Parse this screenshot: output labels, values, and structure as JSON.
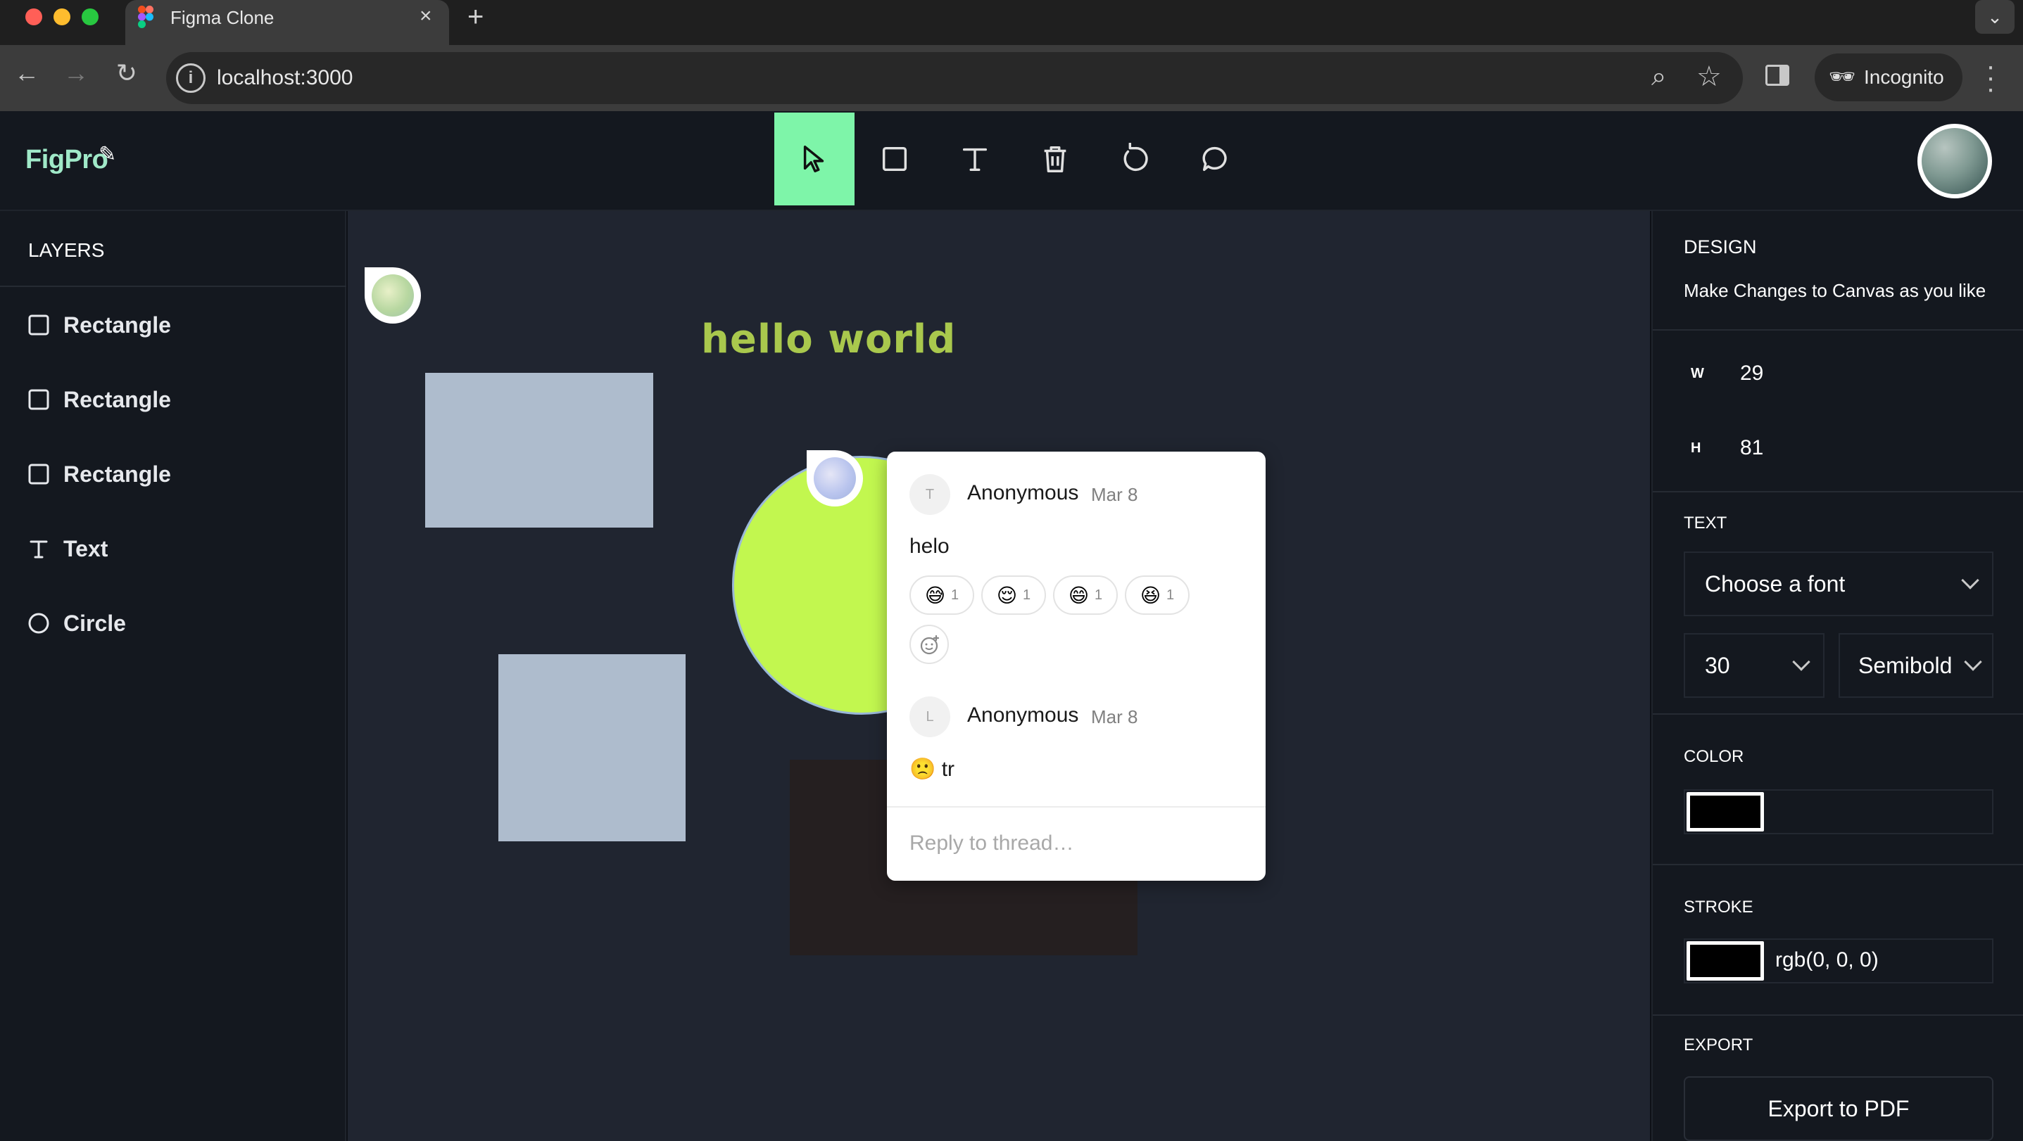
{
  "browser": {
    "tab_title": "Figma Clone",
    "url": "localhost:3000",
    "incognito_label": "Incognito"
  },
  "header": {
    "logo": "FigPro",
    "tools": [
      "select-tool",
      "rectangle-tool",
      "text-tool",
      "delete-tool",
      "reset-tool",
      "comments-tool"
    ],
    "active_tool": "select-tool",
    "active_color": "#7ef5a9"
  },
  "layers": {
    "title": "LAYERS",
    "items": [
      {
        "label": "Rectangle",
        "icon": "square-icon"
      },
      {
        "label": "Rectangle",
        "icon": "square-icon"
      },
      {
        "label": "Rectangle",
        "icon": "square-icon"
      },
      {
        "label": "Text",
        "icon": "text-icon"
      },
      {
        "label": "Circle",
        "icon": "circle-icon"
      }
    ]
  },
  "canvas": {
    "text_object": "hello world",
    "thread": {
      "comments": [
        {
          "avatar_initial": "T",
          "author": "Anonymous",
          "date": "Mar 8",
          "body": "helo",
          "reactions": [
            {
              "emoji": "😅",
              "count": "1"
            },
            {
              "emoji": "😌",
              "count": "1"
            },
            {
              "emoji": "😄",
              "count": "1"
            },
            {
              "emoji": "😆",
              "count": "1"
            }
          ]
        },
        {
          "avatar_initial": "L",
          "author": "Anonymous",
          "date": "Mar 8",
          "body": "🙁 tr"
        }
      ],
      "reply_placeholder": "Reply to thread…"
    }
  },
  "design": {
    "title": "DESIGN",
    "subtitle": "Make Changes to Canvas as you like",
    "w_label": "W",
    "w_value": "29",
    "h_label": "H",
    "h_value": "81",
    "text_title": "TEXT",
    "font_family_placeholder": "Choose a font",
    "font_size": "30",
    "font_weight": "Semibold",
    "color_title": "COLOR",
    "fill_color": "#000000",
    "stroke_title": "STROKE",
    "stroke_value": "rgb(0, 0, 0)",
    "export_title": "EXPORT",
    "export_label": "Export to PDF"
  }
}
